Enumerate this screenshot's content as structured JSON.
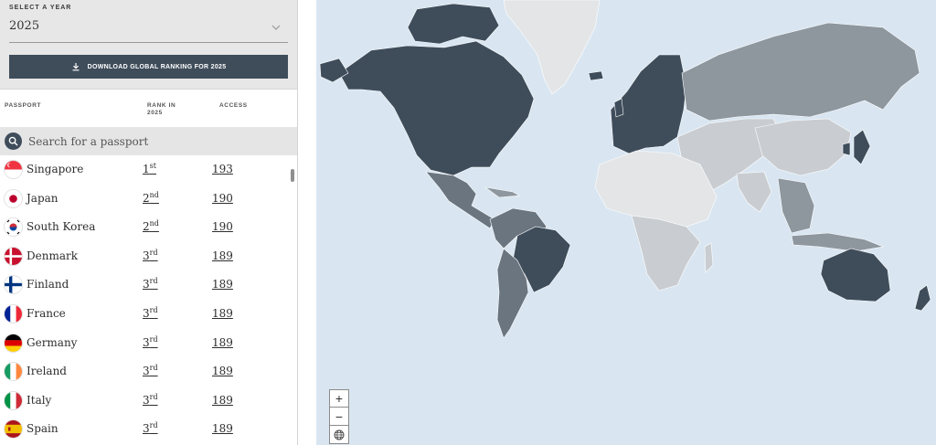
{
  "year_selector": {
    "label": "SELECT A YEAR",
    "value": "2025"
  },
  "download_button": {
    "label": "DOWNLOAD GLOBAL RANKING FOR 2025"
  },
  "columns": {
    "passport": "PASSPORT",
    "rank_line1": "RANK IN",
    "rank_line2": "2025",
    "access": "ACCESS"
  },
  "search": {
    "placeholder": "Search for a passport"
  },
  "rows": [
    {
      "country": "Singapore",
      "rank": "1",
      "suffix": "st",
      "access": "193",
      "flag": "singapore-flag"
    },
    {
      "country": "Japan",
      "rank": "2",
      "suffix": "nd",
      "access": "190",
      "flag": "japan-flag"
    },
    {
      "country": "South Korea",
      "rank": "2",
      "suffix": "nd",
      "access": "190",
      "flag": "south-korea-flag"
    },
    {
      "country": "Denmark",
      "rank": "3",
      "suffix": "rd",
      "access": "189",
      "flag": "denmark-flag"
    },
    {
      "country": "Finland",
      "rank": "3",
      "suffix": "rd",
      "access": "189",
      "flag": "finland-flag"
    },
    {
      "country": "France",
      "rank": "3",
      "suffix": "rd",
      "access": "189",
      "flag": "france-flag"
    },
    {
      "country": "Germany",
      "rank": "3",
      "suffix": "rd",
      "access": "189",
      "flag": "germany-flag"
    },
    {
      "country": "Ireland",
      "rank": "3",
      "suffix": "rd",
      "access": "189",
      "flag": "ireland-flag"
    },
    {
      "country": "Italy",
      "rank": "3",
      "suffix": "rd",
      "access": "189",
      "flag": "italy-flag"
    },
    {
      "country": "Spain",
      "rank": "3",
      "suffix": "rd",
      "access": "189",
      "flag": "spain-flag"
    }
  ],
  "map": {
    "zoom_in": "+",
    "zoom_out": "−",
    "globe": "globe-icon"
  },
  "colors": {
    "button": "#3f4d5b",
    "ocean": "#d9e6f1",
    "strong_access": "#3f4d5b",
    "medium_access": "#6a7580",
    "low_access": "#8e969e",
    "weak_access": "#c9cdd1",
    "lowest_access": "#e3e5e7"
  }
}
